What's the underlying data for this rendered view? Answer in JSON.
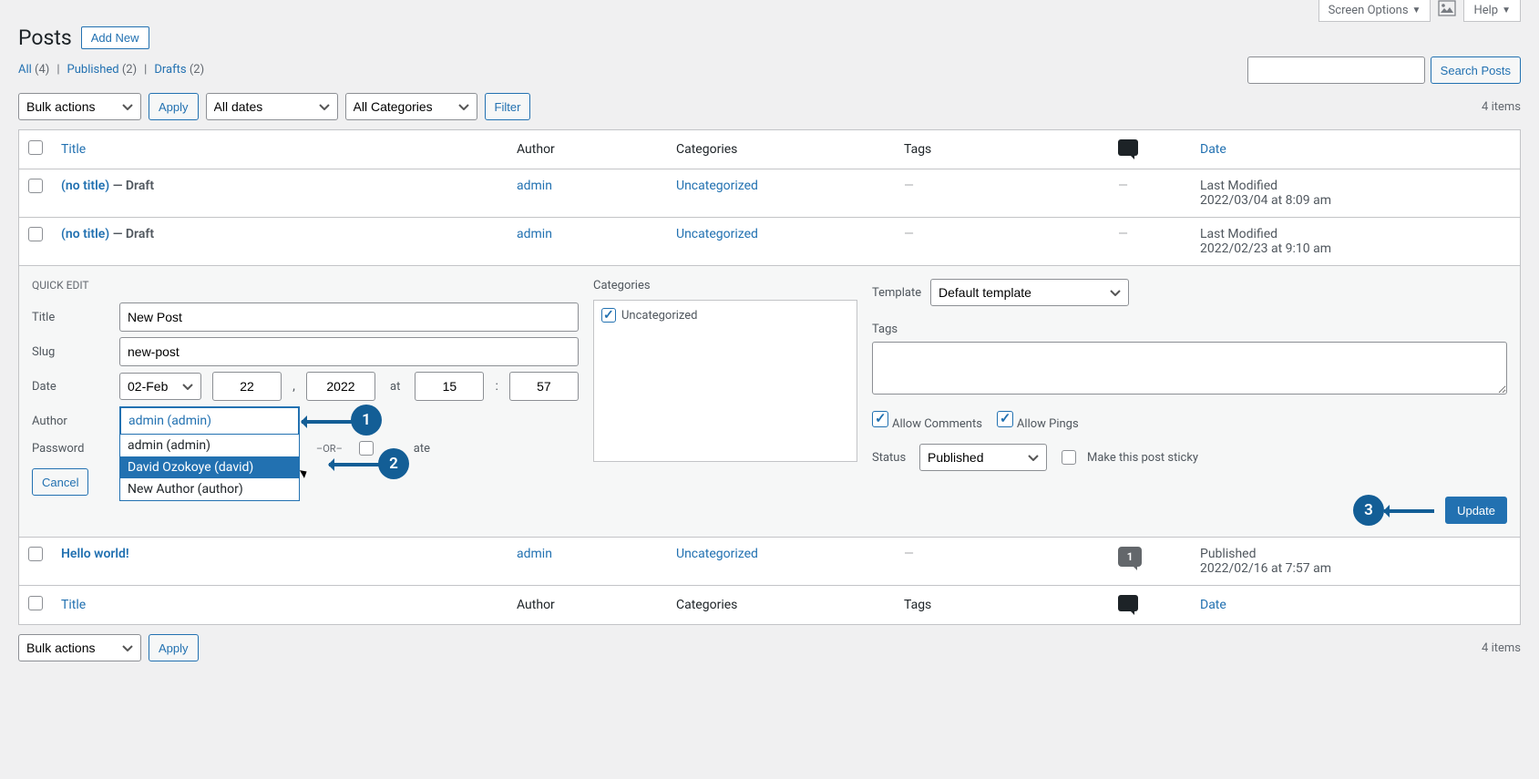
{
  "topbar": {
    "screen_options": "Screen Options",
    "help": "Help"
  },
  "heading": {
    "title": "Posts",
    "add_new": "Add New"
  },
  "filters": {
    "links": [
      {
        "label": "All",
        "count": "(4)"
      },
      {
        "label": "Published",
        "count": "(2)"
      },
      {
        "label": "Drafts",
        "count": "(2)"
      }
    ]
  },
  "search_btn": "Search Posts",
  "tablenav": {
    "bulk": "Bulk actions",
    "apply": "Apply",
    "dates": "All dates",
    "cats": "All Categories",
    "filter": "Filter",
    "count": "4 items"
  },
  "columns": {
    "title": "Title",
    "author": "Author",
    "categories": "Categories",
    "tags": "Tags",
    "date": "Date"
  },
  "rows": [
    {
      "title": "(no title)",
      "status": " — Draft",
      "author": "admin",
      "cat": "Uncategorized",
      "tags": "—",
      "comments": "—",
      "date_label": "Last Modified",
      "date_val": "2022/03/04 at 8:09 am"
    },
    {
      "title": "(no title)",
      "status": " — Draft",
      "author": "admin",
      "cat": "Uncategorized",
      "tags": "—",
      "comments": "—",
      "date_label": "Last Modified",
      "date_val": "2022/02/23 at 9:10 am"
    }
  ],
  "row4": {
    "title": "Hello world!",
    "author": "admin",
    "cat": "Uncategorized",
    "tags": "—",
    "comments": "1",
    "date_label": "Published",
    "date_val": "2022/02/16 at 7:57 am"
  },
  "quickedit": {
    "legend": "QUICK EDIT",
    "title_label": "Title",
    "title_val": "New Post",
    "slug_label": "Slug",
    "slug_val": "new-post",
    "date_label": "Date",
    "month": "02-Feb",
    "day": "22",
    "year": "2022",
    "at": "at",
    "hour": "15",
    "minute": "57",
    "author_label": "Author",
    "author_val": "admin (admin)",
    "author_options": [
      "admin (admin)",
      "David Ozokoye (david)",
      "New Author (author)"
    ],
    "password_label": "Password",
    "or": "–OR–",
    "private_label": "ate",
    "categories_label": "Categories",
    "cat_option": "Uncategorized",
    "template_label": "Template",
    "template_val": "Default template",
    "tags_label": "Tags",
    "allow_comments": "Allow Comments",
    "allow_pings": "Allow Pings",
    "status_label": "Status",
    "status_val": "Published",
    "sticky": "Make this post sticky",
    "cancel": "Cancel",
    "update": "Update"
  },
  "annotations": {
    "1": "1",
    "2": "2",
    "3": "3"
  }
}
